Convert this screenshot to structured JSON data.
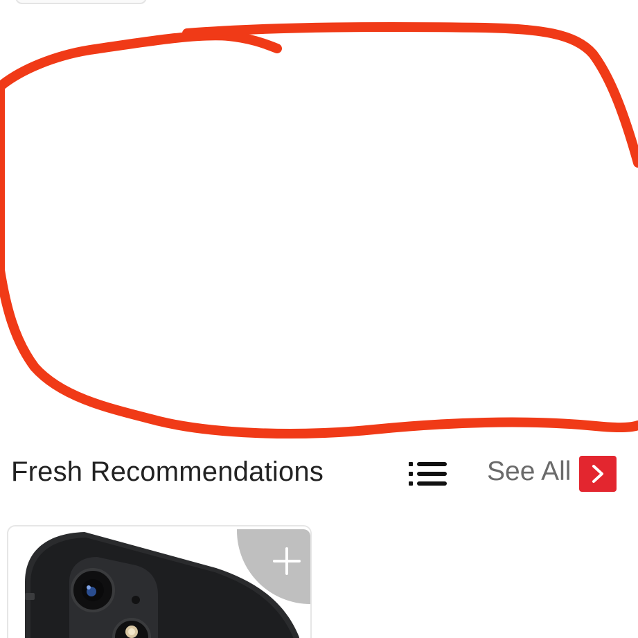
{
  "section": {
    "title": "Fresh Recommendations",
    "see_all_label": "See All"
  },
  "colors": {
    "annotation_stroke": "#f03a17",
    "accent_red": "#e3262f",
    "title_text": "#222222",
    "link_text": "#6a6a6a",
    "add_button_bg": "#bfbfbf"
  },
  "icons": {
    "list_view": "list-view-icon",
    "see_all_arrow": "chevron-right-icon",
    "add": "plus-icon"
  }
}
